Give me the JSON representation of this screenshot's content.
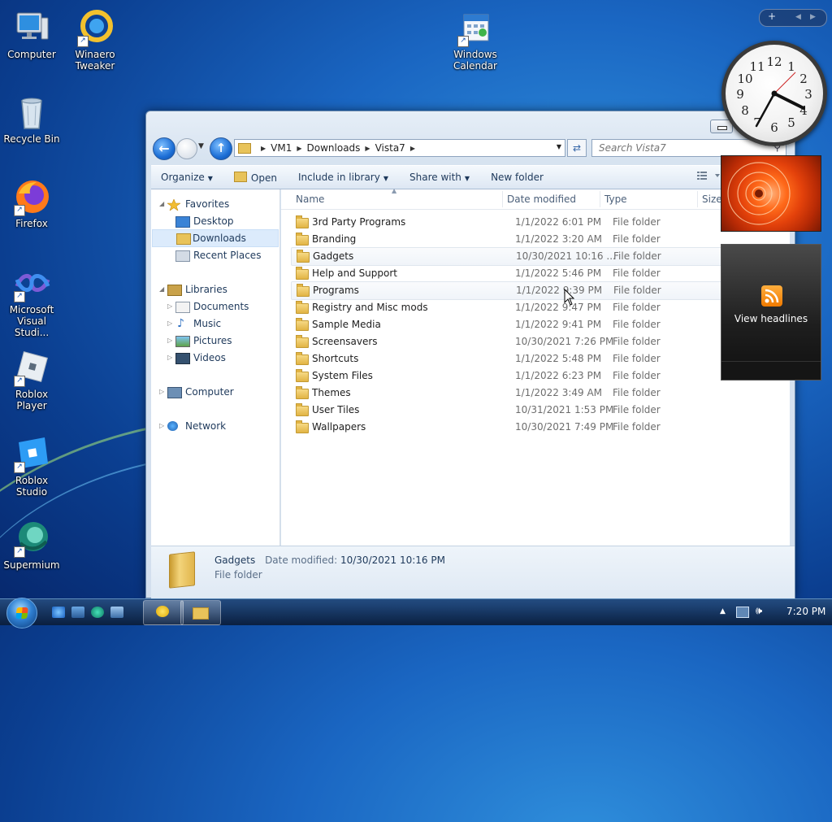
{
  "desktop": {
    "icons": [
      {
        "label": "Computer",
        "line2": ""
      },
      {
        "label": "Winaero",
        "line2": "Tweaker"
      },
      {
        "label": "Windows",
        "line2": "Calendar"
      },
      {
        "label": "Recycle Bin",
        "line2": ""
      },
      {
        "label": "Firefox",
        "line2": ""
      },
      {
        "label": "Microsoft",
        "line2": "Visual Studi..."
      },
      {
        "label": "Roblox Player",
        "line2": ""
      },
      {
        "label": "Roblox Studio",
        "line2": ""
      },
      {
        "label": "Supermium",
        "line2": ""
      }
    ]
  },
  "explorer": {
    "breadcrumb": [
      "VM1",
      "Downloads",
      "Vista7"
    ],
    "search_placeholder": "Search Vista7",
    "toolbar": {
      "organize": "Organize",
      "open": "Open",
      "include": "Include in library",
      "share": "Share with",
      "new_folder": "New folder"
    },
    "nav": {
      "favorites": "Favorites",
      "desktop": "Desktop",
      "downloads": "Downloads",
      "recent": "Recent Places",
      "libraries": "Libraries",
      "documents": "Documents",
      "music": "Music",
      "pictures": "Pictures",
      "videos": "Videos",
      "computer": "Computer",
      "network": "Network"
    },
    "columns": {
      "name": "Name",
      "date": "Date modified",
      "type": "Type",
      "size": "Size"
    },
    "rows": [
      {
        "name": "3rd Party Programs",
        "date": "1/1/2022 6:01 PM",
        "type": "File folder"
      },
      {
        "name": "Branding",
        "date": "1/1/2022 3:20 AM",
        "type": "File folder"
      },
      {
        "name": "Gadgets",
        "date": "10/30/2021 10:16 ...",
        "type": "File folder"
      },
      {
        "name": "Help and Support",
        "date": "1/1/2022 5:46 PM",
        "type": "File folder"
      },
      {
        "name": "Programs",
        "date": "1/1/2022 9:39 PM",
        "type": "File folder"
      },
      {
        "name": "Registry and Misc mods",
        "date": "1/1/2022 9:47 PM",
        "type": "File folder"
      },
      {
        "name": "Sample Media",
        "date": "1/1/2022 9:41 PM",
        "type": "File folder"
      },
      {
        "name": "Screensavers",
        "date": "10/30/2021 7:26 PM",
        "type": "File folder"
      },
      {
        "name": "Shortcuts",
        "date": "1/1/2022 5:48 PM",
        "type": "File folder"
      },
      {
        "name": "System Files",
        "date": "1/1/2022 6:23 PM",
        "type": "File folder"
      },
      {
        "name": "Themes",
        "date": "1/1/2022 3:49 AM",
        "type": "File folder"
      },
      {
        "name": "User Tiles",
        "date": "10/31/2021 1:53 PM",
        "type": "File folder"
      },
      {
        "name": "Wallpapers",
        "date": "10/30/2021 7:49 PM",
        "type": "File folder"
      }
    ],
    "details": {
      "name": "Gadgets",
      "date_label": "Date modified:",
      "date_value": "10/30/2021 10:16 PM",
      "type": "File folder"
    }
  },
  "gadgets": {
    "clock_numbers": [
      "12",
      "1",
      "2",
      "3",
      "4",
      "5",
      "6",
      "7",
      "8",
      "9",
      "10",
      "11"
    ],
    "feed_label": "View headlines",
    "add_symbol": "+"
  },
  "taskbar": {
    "time": "7:20 PM"
  }
}
